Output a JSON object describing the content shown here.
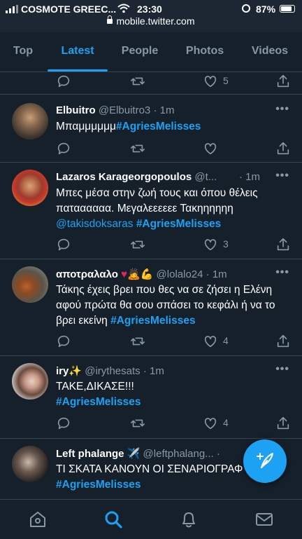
{
  "status_bar": {
    "carrier": "COSMOTE GREEC...",
    "time": "23:30",
    "battery": "87%",
    "battery_level": 0.87,
    "url": "mobile.twitter.com"
  },
  "tabs": [
    {
      "label": "Top",
      "active": false
    },
    {
      "label": "Latest",
      "active": true
    },
    {
      "label": "People",
      "active": false
    },
    {
      "label": "Photos",
      "active": false
    },
    {
      "label": "Videos",
      "active": false
    }
  ],
  "partial_tweet": {
    "likes": "5"
  },
  "tweets": [
    {
      "name": "Elbuitro",
      "handle": "@Elbuitro3",
      "dot": "·",
      "age": "1m",
      "text": "Μπαμμμμμμ",
      "hashtag": "#AgriesMelisses",
      "replies": "",
      "retweets": "",
      "likes": ""
    },
    {
      "name": "Lazaros Karageorgopoulos",
      "handle": "@t...",
      "dot": "·",
      "age": "1m",
      "text": "Μπες μέσα στην ζωή τους και όπου θέλεις παταααααα. Μεγαλεεεεεε Τακηηηηηη",
      "mention": "@takisdoksaras",
      "hashtag": "#AgriesMelisses",
      "likes": "3"
    },
    {
      "name": "αποτραλαλο",
      "name_emoji": "♥🙇💪",
      "handle": "@lolalo24",
      "dot": "·",
      "age": "1m",
      "text": "Τάκης έχεις βρει που θες να σε ζήσει η Ελένη αφού πρώτα θα σου σπάσει το κεφάλι ή να το βρει εκείνη",
      "hashtag": "#AgriesMelisses",
      "likes": "4"
    },
    {
      "name": "iry",
      "name_emoji": "✨",
      "handle": "@irythesats",
      "dot": "·",
      "age": "1m",
      "text": "ΤΑΚΕ,ΔΙΚΑΣΕ!!!",
      "hashtag": "#AgriesMelisses",
      "likes": "4"
    },
    {
      "name": "Left phalange",
      "name_emoji": "✈️",
      "handle": "@leftphalang...",
      "dot": "·",
      "text": "ΤΙ ΣΚΑΤΑ ΚΑΝΟΥΝ ΟΙ ΣΕΝΑΡΙΟΓΡΑΦ",
      "hashtag": "#AgriesMelisses"
    }
  ],
  "more_label": "•••",
  "icons": {
    "reply": "reply-icon",
    "retweet": "retweet-icon",
    "like": "heart-icon",
    "share": "share-icon",
    "compose": "compose-tweet-icon",
    "nav": [
      "home-icon",
      "search-icon",
      "notifications-icon",
      "messages-icon"
    ]
  },
  "colors": {
    "background": "#15202b",
    "accent": "#1da1f2",
    "secondary_text": "#8899a6",
    "divider": "#38444d",
    "heart": "#e0245e",
    "emoji_yellow": "#f5b800"
  }
}
